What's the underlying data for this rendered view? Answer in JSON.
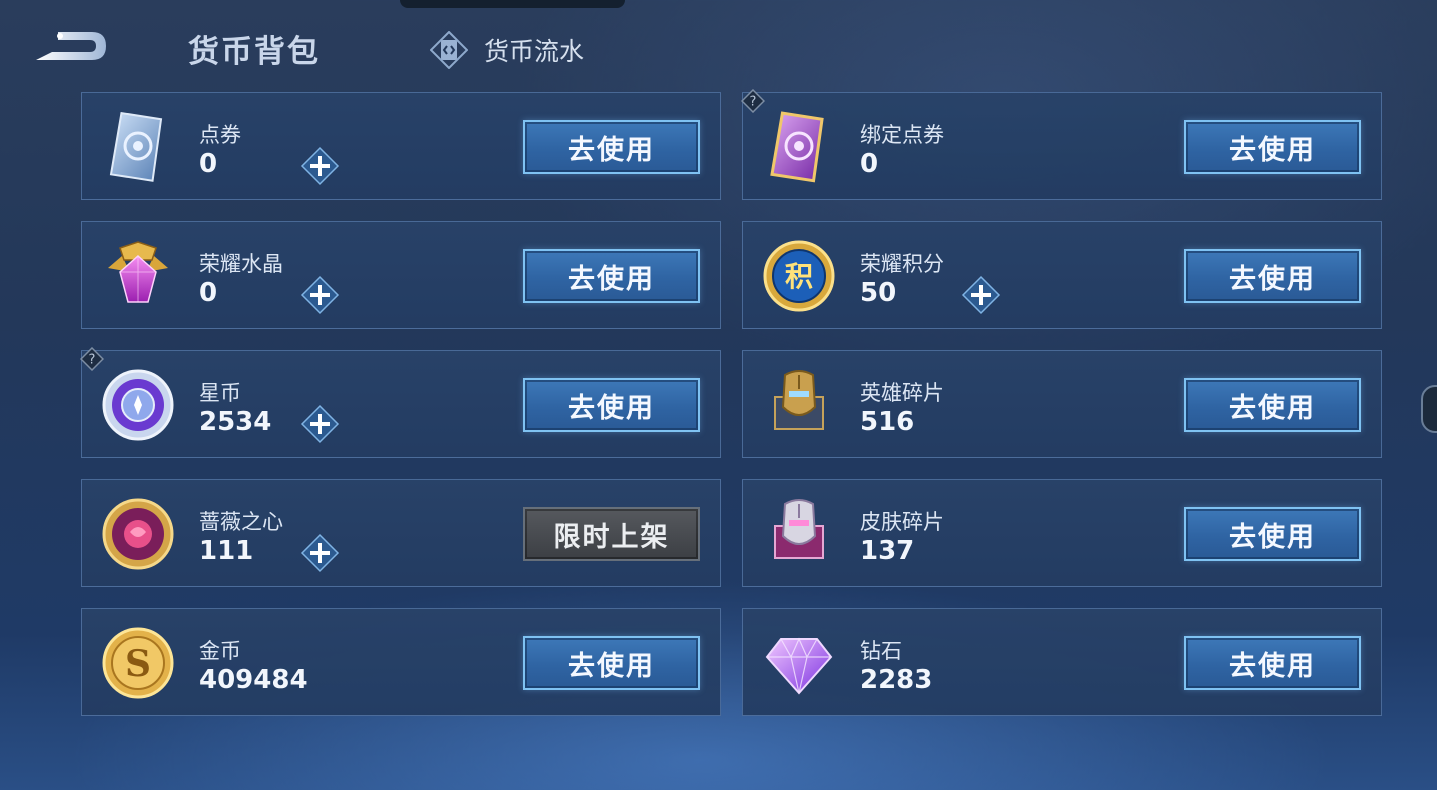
{
  "header": {
    "title": "货币背包",
    "flow_label": "货币流水"
  },
  "cards": [
    {
      "name": "点券",
      "amount": "0",
      "button": "去使用",
      "has_plus": true,
      "has_help": false,
      "icon": "voucher-card-icon"
    },
    {
      "name": "绑定点券",
      "amount": "0",
      "button": "去使用",
      "has_plus": false,
      "has_help": true,
      "icon": "bound-voucher-card-icon"
    },
    {
      "name": "荣耀水晶",
      "amount": "0",
      "button": "去使用",
      "has_plus": true,
      "has_help": false,
      "icon": "glory-crystal-icon"
    },
    {
      "name": "荣耀积分",
      "amount": "50",
      "button": "去使用",
      "has_plus": true,
      "has_help": false,
      "icon": "glory-points-icon"
    },
    {
      "name": "星币",
      "amount": "2534",
      "button": "去使用",
      "has_plus": true,
      "has_help": true,
      "icon": "star-coin-icon"
    },
    {
      "name": "英雄碎片",
      "amount": "516",
      "button": "去使用",
      "has_plus": false,
      "has_help": false,
      "icon": "hero-fragment-icon"
    },
    {
      "name": "蔷薇之心",
      "amount": "111",
      "button": "限时上架",
      "button_disabled": true,
      "has_plus": true,
      "has_help": false,
      "icon": "rose-heart-icon"
    },
    {
      "name": "皮肤碎片",
      "amount": "137",
      "button": "去使用",
      "has_plus": false,
      "has_help": false,
      "icon": "skin-fragment-icon"
    },
    {
      "name": "金币",
      "amount": "409484",
      "button": "去使用",
      "has_plus": false,
      "has_help": false,
      "icon": "gold-coin-icon"
    },
    {
      "name": "钻石",
      "amount": "2283",
      "button": "去使用",
      "has_plus": false,
      "has_help": false,
      "icon": "diamond-icon"
    }
  ],
  "colors": {
    "accent": "#7fc2f2",
    "button": "#3d78b8",
    "disabled_button": "#4a4d52"
  }
}
